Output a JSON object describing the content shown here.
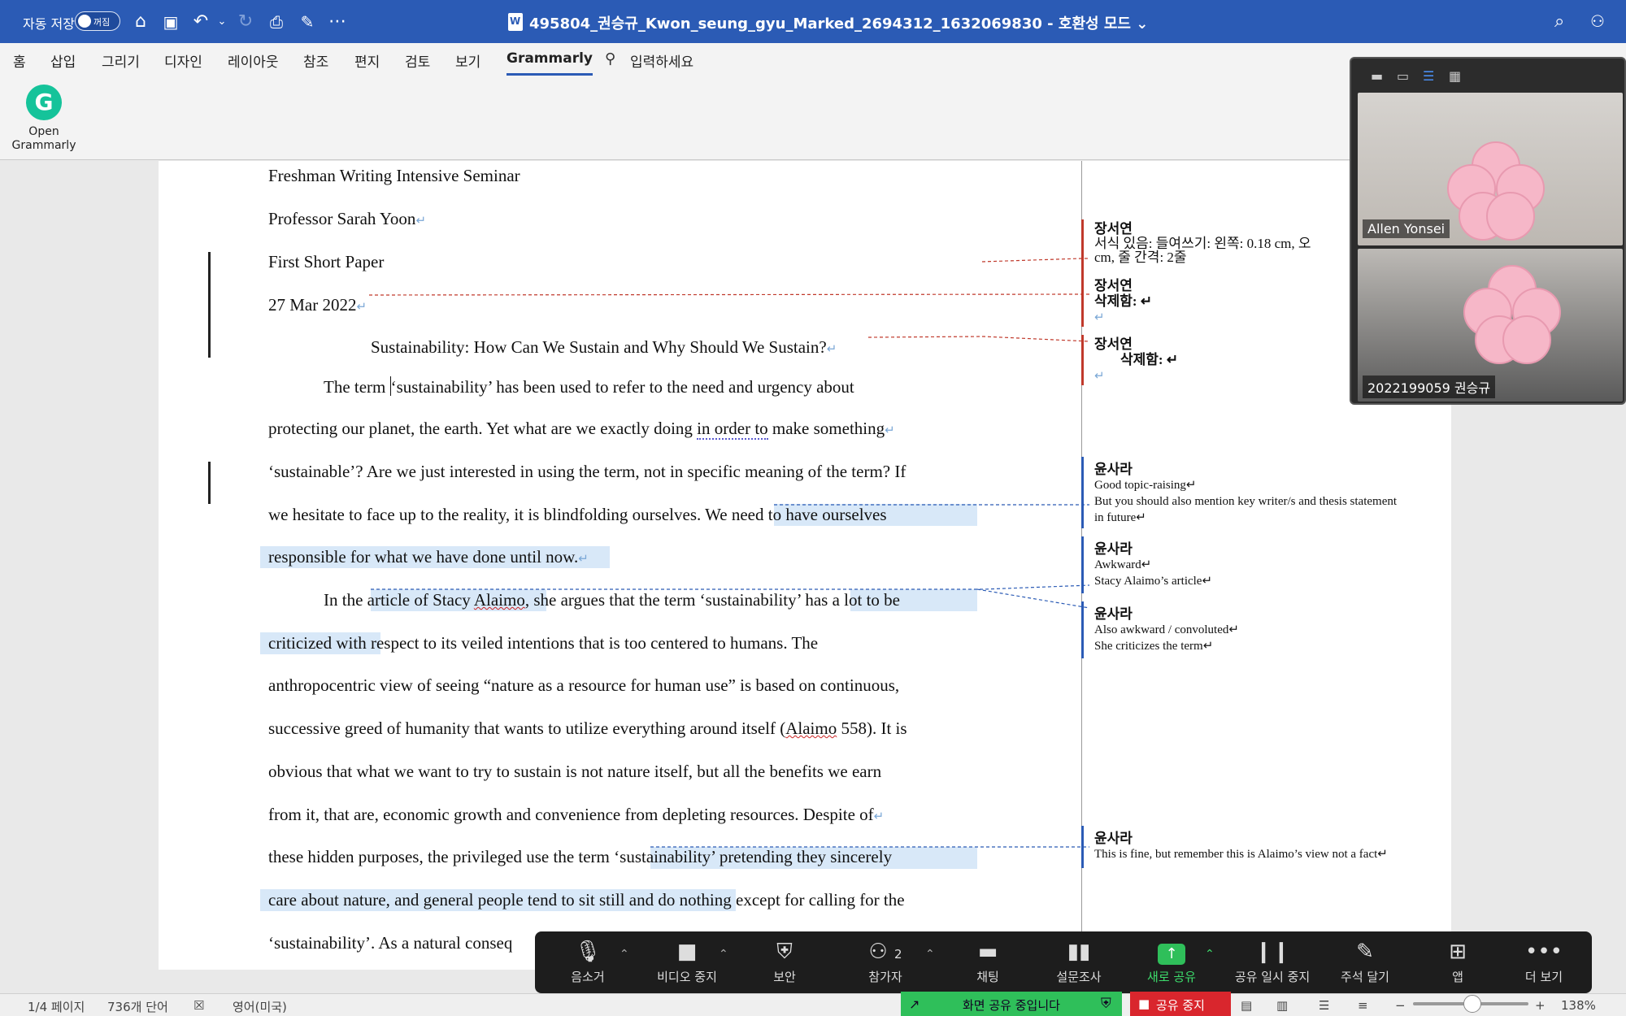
{
  "titlebar": {
    "autosave_label": "자동 저장",
    "autosave_state": "꺼짐",
    "doc_title": "495804_권승규_Kwon_seung_gyu_Marked_2694312_1632069830 - 호환성 모드 ⌄",
    "icons": [
      "home-icon",
      "save-icon",
      "undo-icon",
      "redo-icon",
      "print-icon",
      "save-as-icon",
      "more-icon",
      "search-icon",
      "share-icon"
    ]
  },
  "ribbon": {
    "tabs": [
      "홈",
      "삽입",
      "그리기",
      "디자인",
      "레이아웃",
      "참조",
      "편지",
      "검토",
      "보기",
      "Grammarly"
    ],
    "active_tab": "Grammarly",
    "tell_me": "입력하세요",
    "grammarly_button": "Open\nGrammarly"
  },
  "document": {
    "header": [
      "Freshman Writing Intensive Seminar",
      "Professor Sarah Yoon",
      "First Short Paper",
      "27 Mar 2022"
    ],
    "title": "Sustainability: How Can We Sustain and Why Should We Sustain?",
    "p1": [
      [
        "The term ",
        "‘sustainability’ has been used to refer to the need and urgency about"
      ],
      [
        "protecting our planet, the earth. Yet what are we exactly doing ",
        "in order to",
        " make something"
      ],
      [
        "‘sustainable’? Are we just interested in using the term, not in specific meaning of the term? If"
      ],
      [
        "we hesitate to face up to the reality, it is blindfolding ourselves. We ",
        "need to have ourselves"
      ],
      [
        "responsible for what we have done until now."
      ]
    ],
    "p2": [
      [
        "In the ",
        "article of Stacy ",
        "Alaimo",
        ", she argues that the term ‘sustainability’ ",
        "has a lot to be"
      ],
      [
        "criticized with ",
        "respect to its veiled intentions that is too centered to humans. The"
      ],
      [
        "anthropocentric view of seeing “nature as a resource for human use” is based on continuous,"
      ],
      [
        "successive greed of humanity that wants to utilize everything around itself (",
        "Alaimo",
        " 558). It is"
      ],
      [
        "obvious that what we want to try to sustain is not nature itself, but all the benefits we earn"
      ],
      [
        "from it, that are, economic growth and convenience from depleting resources. Despite of"
      ],
      [
        "these hidden purposes, the privileged use the term ‘",
        "sustainability’ pretending they sincerely"
      ],
      [
        "care about nature, and general people tend to sit still and do no",
        "thing except for calling for the"
      ],
      [
        "‘sustainability’. As a natural conseq"
      ]
    ]
  },
  "comments": [
    {
      "author": "장서연",
      "lines": [
        "서식 있음: 들여쓰기: 왼쪽:  0.18 cm, 오",
        "cm, 줄 간격: 2줄"
      ],
      "color": "#c0392b"
    },
    {
      "author": "장서연",
      "lines": [
        "삭제함: ↵",
        "↵"
      ],
      "color": "#c0392b"
    },
    {
      "author": "장서연",
      "lines": [
        "삭제함: ↵",
        "↵"
      ],
      "color": "#c0392b"
    },
    {
      "author": "윤사라",
      "lines": [
        "Good topic-raising↵",
        "But you should also mention key writer/s and thesis statement",
        "in future↵"
      ],
      "color": "#2b5bb5"
    },
    {
      "author": "윤사라",
      "lines": [
        "Awkward↵",
        "Stacy Alaimo’s article↵"
      ],
      "color": "#2b5bb5"
    },
    {
      "author": "윤사라",
      "lines": [
        "Also awkward / convoluted↵",
        "She criticizes the term↵"
      ],
      "color": "#2b5bb5"
    },
    {
      "author": "윤사라",
      "lines": [
        "This is fine, but remember this is Alaimo’s view not a fact↵"
      ],
      "color": "#2b5bb5"
    }
  ],
  "zoom_gallery": {
    "participants": [
      {
        "name": "Allen Yonsei"
      },
      {
        "name": "2022199059 권승규"
      }
    ]
  },
  "zoom_toolbar": {
    "buttons": [
      "음소거",
      "비디오 중지",
      "보안",
      "참가자",
      "채팅",
      "설문조사",
      "새로 공유",
      "공유 일시 중지",
      "주석 달기",
      "앱",
      "더 보기"
    ],
    "participant_count": "2",
    "sharing_banner": "화면 공유 중입니다",
    "stop_share": "공유 중지"
  },
  "statusbar": {
    "page": "1/4 페이지",
    "words": "736개 단어",
    "language": "영어(미국)",
    "zoom": "138%",
    "zoom_level": 138
  },
  "colors": {
    "title_bar": "#2b5bb5",
    "highlight": "#d8e8f8",
    "zoom_green": "#2fbf5a",
    "stop_red": "#d9262d"
  }
}
